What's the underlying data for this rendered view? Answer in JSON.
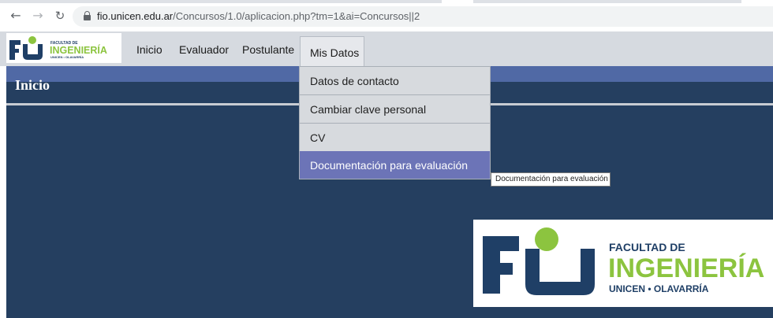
{
  "browser": {
    "url_host": "fio.unicen.edu.ar",
    "url_path": "/Concursos/1.0/aplicacion.php?tm=1&ai=Concursos||2"
  },
  "logo": {
    "line1": "FACULTAD DE",
    "line2": "INGENIERÍA",
    "line3": "UNICEN • OLAVARRÍA",
    "colors": {
      "navy": "#1f3f66",
      "green": "#8cc43f"
    }
  },
  "menu": {
    "items": [
      "Inicio",
      "Evaluador",
      "Postulante",
      "Mis Datos"
    ]
  },
  "page": {
    "title": "Inicio"
  },
  "dropdown": {
    "items": [
      "Datos de contacto",
      "Cambiar clave personal",
      "CV",
      "Documentación para evaluación"
    ],
    "highlighted_index": 3
  },
  "tooltip": "Documentación para evaluación",
  "colors": {
    "page_background": "#253f60",
    "title_stripe": "#5069a5",
    "menu_bar": "#d6dae0",
    "highlight": "#6c74b7"
  }
}
